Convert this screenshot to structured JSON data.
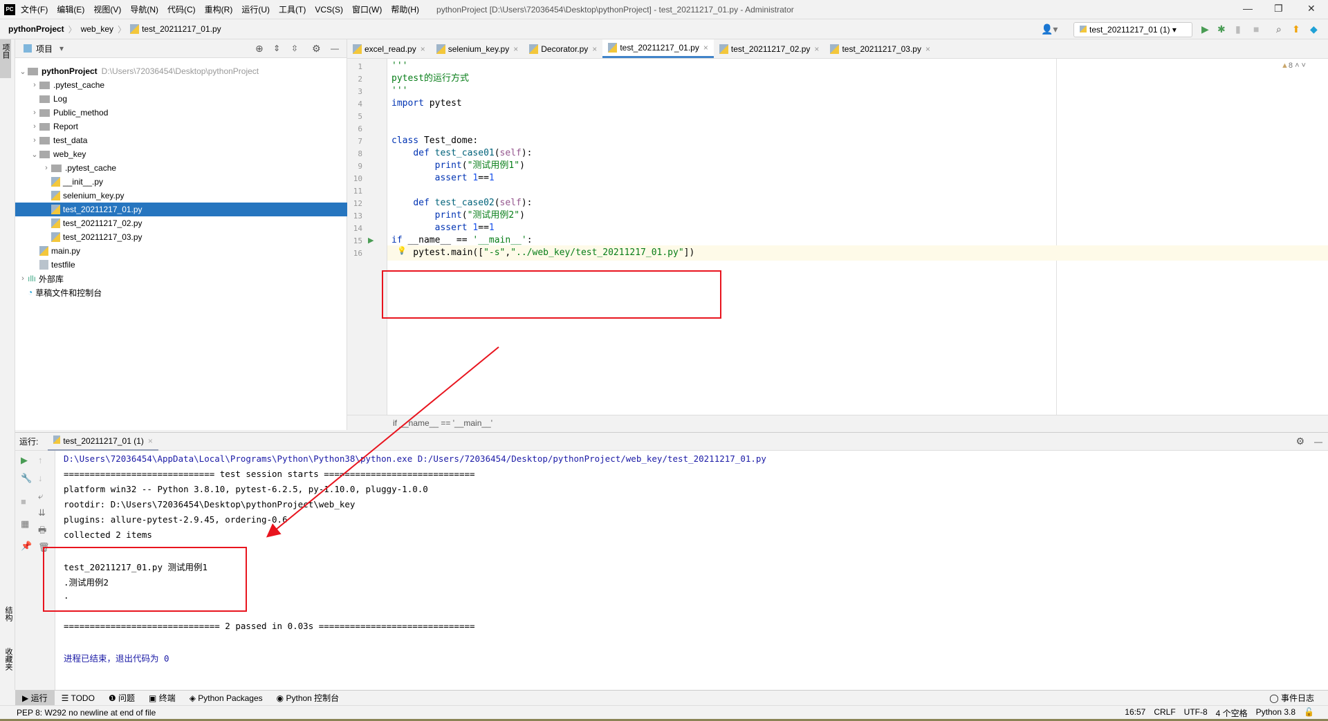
{
  "menubar": {
    "logo": "PC",
    "items": [
      "文件(F)",
      "编辑(E)",
      "视图(V)",
      "导航(N)",
      "代码(C)",
      "重构(R)",
      "运行(U)",
      "工具(T)",
      "VCS(S)",
      "窗口(W)",
      "帮助(H)"
    ],
    "title": "pythonProject [D:\\Users\\72036454\\Desktop\\pythonProject] - test_20211217_01.py - Administrator"
  },
  "breadcrumb": [
    "pythonProject",
    "web_key",
    "test_20211217_01.py"
  ],
  "toolbar": {
    "run_config": "test_20211217_01 (1)"
  },
  "project": {
    "header": "项目",
    "tree": [
      {
        "label": "pythonProject",
        "path": "D:\\Users\\72036454\\Desktop\\pythonProject",
        "depth": 0,
        "type": "folder",
        "expanded": true
      },
      {
        "label": ".pytest_cache",
        "depth": 1,
        "type": "folder",
        "collapsed": true
      },
      {
        "label": "Log",
        "depth": 1,
        "type": "folder"
      },
      {
        "label": "Public_method",
        "depth": 1,
        "type": "folder",
        "collapsed": true
      },
      {
        "label": "Report",
        "depth": 1,
        "type": "folder",
        "collapsed": true
      },
      {
        "label": "test_data",
        "depth": 1,
        "type": "folder",
        "collapsed": true
      },
      {
        "label": "web_key",
        "depth": 1,
        "type": "folder",
        "expanded": true
      },
      {
        "label": ".pytest_cache",
        "depth": 2,
        "type": "folder",
        "collapsed": true
      },
      {
        "label": "__init__.py",
        "depth": 2,
        "type": "py"
      },
      {
        "label": "selenium_key.py",
        "depth": 2,
        "type": "py"
      },
      {
        "label": "test_20211217_01.py",
        "depth": 2,
        "type": "py",
        "selected": true
      },
      {
        "label": "test_20211217_02.py",
        "depth": 2,
        "type": "py"
      },
      {
        "label": "test_20211217_03.py",
        "depth": 2,
        "type": "py"
      },
      {
        "label": "main.py",
        "depth": 1,
        "type": "py"
      },
      {
        "label": "testfile",
        "depth": 1,
        "type": "file"
      },
      {
        "label": "外部库",
        "depth": 0,
        "type": "lib",
        "collapsed": true
      },
      {
        "label": "草稿文件和控制台",
        "depth": 0,
        "type": "scratch"
      }
    ]
  },
  "tabs": [
    "excel_read.py",
    "selenium_key.py",
    "Decorator.py",
    "test_20211217_01.py",
    "test_20211217_02.py",
    "test_20211217_03.py"
  ],
  "active_tab": "test_20211217_01.py",
  "editor": {
    "warnings": "8",
    "breadcrumb": "if __name__ == '__main__'",
    "lines": [
      "'''",
      "pytest的运行方式",
      "'''",
      "import pytest",
      "",
      "",
      "class Test_dome:",
      "    def test_case01(self):",
      "        print(\"测试用例1\")",
      "        assert 1==1",
      "",
      "    def test_case02(self):",
      "        print(\"测试用例2\")",
      "        assert 1==1",
      "if __name__ == '__main__':",
      "    pytest.main([\"-s\",\"../web_key/test_20211217_01.py\"])"
    ]
  },
  "run": {
    "label": "运行:",
    "tab": "test_20211217_01 (1)",
    "output": [
      "D:\\Users\\72036454\\AppData\\Local\\Programs\\Python\\Python38\\python.exe D:/Users/72036454/Desktop/pythonProject/web_key/test_20211217_01.py",
      "============================= test session starts =============================",
      "platform win32 -- Python 3.8.10, pytest-6.2.5, py-1.10.0, pluggy-1.0.0",
      "rootdir: D:\\Users\\72036454\\Desktop\\pythonProject\\web_key",
      "plugins: allure-pytest-2.9.45, ordering-0.6",
      "collected 2 items",
      "",
      "test_20211217_01.py 测试用例1",
      ".测试用例2",
      ".",
      "",
      "============================== 2 passed in 0.03s ==============================",
      "",
      "进程已结束，退出代码为 0"
    ]
  },
  "bottom_tabs": [
    "运行",
    "TODO",
    "问题",
    "终端",
    "Python Packages",
    "Python 控制台"
  ],
  "event_log": "事件日志",
  "side_labels": {
    "project": "项目",
    "structure": "结构",
    "favorites": "收藏夹"
  },
  "status": {
    "message": "PEP 8: W292 no newline at end of file",
    "position": "16:57",
    "line_sep": "CRLF",
    "encoding": "UTF-8",
    "indent": "4 个空格",
    "interpreter": "Python 3.8"
  },
  "colors": {
    "selection": "#2675bf",
    "annotation": "#e8141e",
    "run_green": "#499c54"
  }
}
